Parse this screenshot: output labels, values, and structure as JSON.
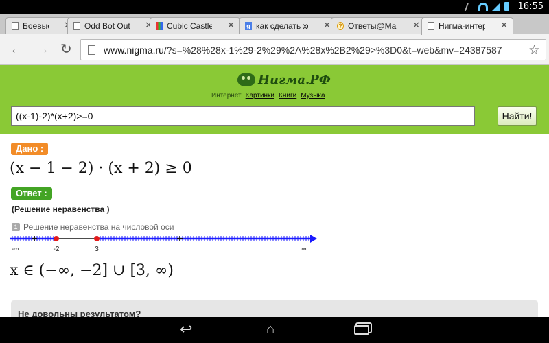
{
  "status_bar": {
    "time": "16:55",
    "icons": [
      "mute-icon",
      "wifi-icon",
      "signal-icon",
      "battery-icon"
    ]
  },
  "tabs": [
    {
      "label": "Боевые Б",
      "favicon": "page-icon"
    },
    {
      "label": "Odd Bot Out для",
      "favicon": "page-icon"
    },
    {
      "label": "Cubic Castles д",
      "favicon": "cubic-castles-icon"
    },
    {
      "label": "как сделать хор",
      "favicon": "google-icon"
    },
    {
      "label": "Ответы@Mail.R",
      "favicon": "question-icon"
    },
    {
      "label": "Нигма-интерне",
      "favicon": "page-icon",
      "active": true
    }
  ],
  "toolbar": {
    "url_host": "www.nigma.ru",
    "url_rest": "/?s=%28%28x-1%29-2%29%2A%28x%2B2%29>%3D0&t=web&mv=24387587"
  },
  "site": {
    "logo_text": "Нигма.РФ",
    "nav_static": "Интернет",
    "nav_links": [
      "Картинки",
      "Книги",
      "Музыка"
    ],
    "search_value": "((x-1)-2)*(x+2)>=0",
    "search_button": "Найти!"
  },
  "result": {
    "given_label": "Дано :",
    "given_expr": "(x − 1 − 2) · (x + 2) ≥ 0",
    "answer_label": "Ответ :",
    "solution_title": "(Решение неравенства )",
    "step_number": "1",
    "step_label": "Решение неравенства на числовой оси",
    "number_line": {
      "left_label": "-∞",
      "right_label": "∞",
      "points": [
        {
          "label": "-2",
          "value": -2,
          "included": true
        },
        {
          "label": "3",
          "value": 3,
          "included": true
        }
      ],
      "solution_sets": [
        "(-∞, -2]",
        "[3, ∞)"
      ],
      "sign_marks": [
        "+",
        "+"
      ]
    },
    "answer_expr": "x ∈  (−∞, −2] ∪ [3, ∞)"
  },
  "feedback": {
    "title": "Не довольны результатом?"
  },
  "colors": {
    "site_green": "#8ac936",
    "given_orange": "#f28c28",
    "answer_green": "#43a424",
    "line_blue": "#1a1aff",
    "point_red": "#e31b1b"
  }
}
